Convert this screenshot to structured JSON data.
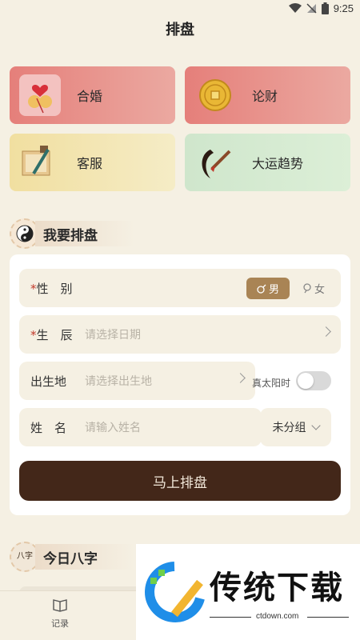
{
  "status": {
    "time": "9:25"
  },
  "header": {
    "title": "排盘"
  },
  "tiles": [
    {
      "label": "合婚",
      "icon": "heart-couple-icon"
    },
    {
      "label": "论财",
      "icon": "gold-coin-icon"
    },
    {
      "label": "客服",
      "icon": "scroll-brush-icon"
    },
    {
      "label": "大运趋势",
      "icon": "ink-brush-icon"
    }
  ],
  "section_paipan": {
    "title": "我要排盘"
  },
  "form": {
    "gender": {
      "label": "性　别",
      "required": "*",
      "male": "男",
      "female": "女",
      "selected": "男"
    },
    "birth": {
      "label": "生　辰",
      "required": "*",
      "placeholder": "请选择日期"
    },
    "birthplace": {
      "label": "出生地",
      "placeholder": "请选择出生地"
    },
    "solar_time": {
      "label": "真太阳时",
      "enabled": false
    },
    "name": {
      "label": "姓　名",
      "placeholder": "请输入姓名"
    },
    "group": {
      "value": "未分组"
    },
    "submit": "马上排盘"
  },
  "section_today": {
    "title": "今日八字",
    "badge": "八字"
  },
  "tabbar": {
    "record": "记录"
  },
  "watermark": {
    "text": "传统下载",
    "url": "ctdown.com"
  },
  "colors": {
    "primary_dark": "#432719",
    "accent_gold": "#a98455",
    "background": "#f5f0e3"
  }
}
